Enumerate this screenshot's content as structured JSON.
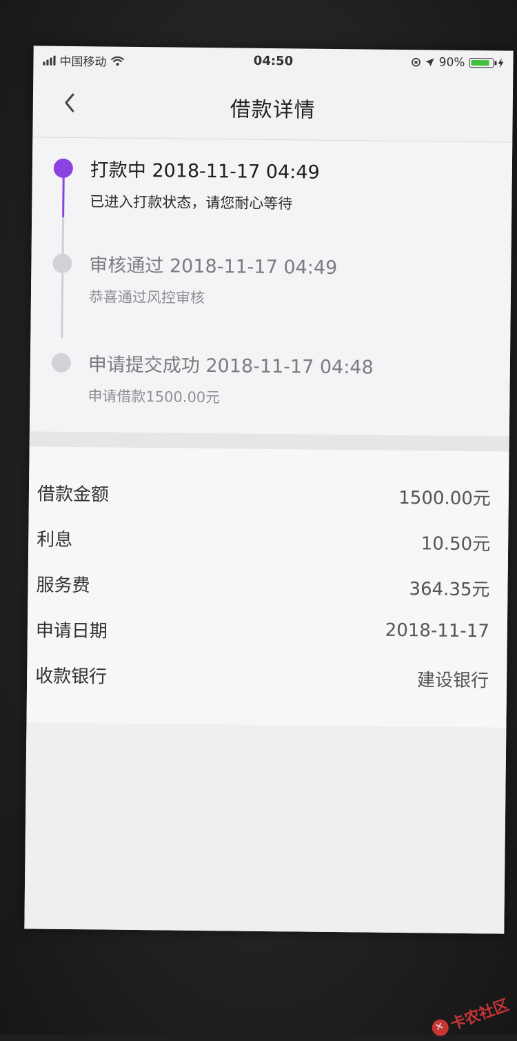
{
  "status_bar": {
    "carrier": "中国移动",
    "time": "04:50",
    "battery_percent": "90%",
    "battery_level": 0.9
  },
  "nav": {
    "title": "借款详情",
    "back_icon": "chevron-left-icon"
  },
  "timeline": [
    {
      "title": "打款中 2018-11-17 04:49",
      "desc": "已进入打款状态，请您耐心等待",
      "state": "active"
    },
    {
      "title": "审核通过 2018-11-17 04:49",
      "desc": "恭喜通过风控审核",
      "state": "done"
    },
    {
      "title": "申请提交成功 2018-11-17 04:48",
      "desc": "申请借款1500.00元",
      "state": "done"
    }
  ],
  "details": [
    {
      "label": "借款金额",
      "value": "1500.00元"
    },
    {
      "label": "利息",
      "value": "10.50元"
    },
    {
      "label": "服务费",
      "value": "364.35元"
    },
    {
      "label": "申请日期",
      "value": "2018-11-17"
    },
    {
      "label": "收款银行",
      "value": "建设银行"
    }
  ],
  "watermark": {
    "text": "卡农社区"
  },
  "colors": {
    "accent": "#8a42e0",
    "inactive_dot": "#d2d2d6",
    "battery": "#3fbf3a"
  }
}
